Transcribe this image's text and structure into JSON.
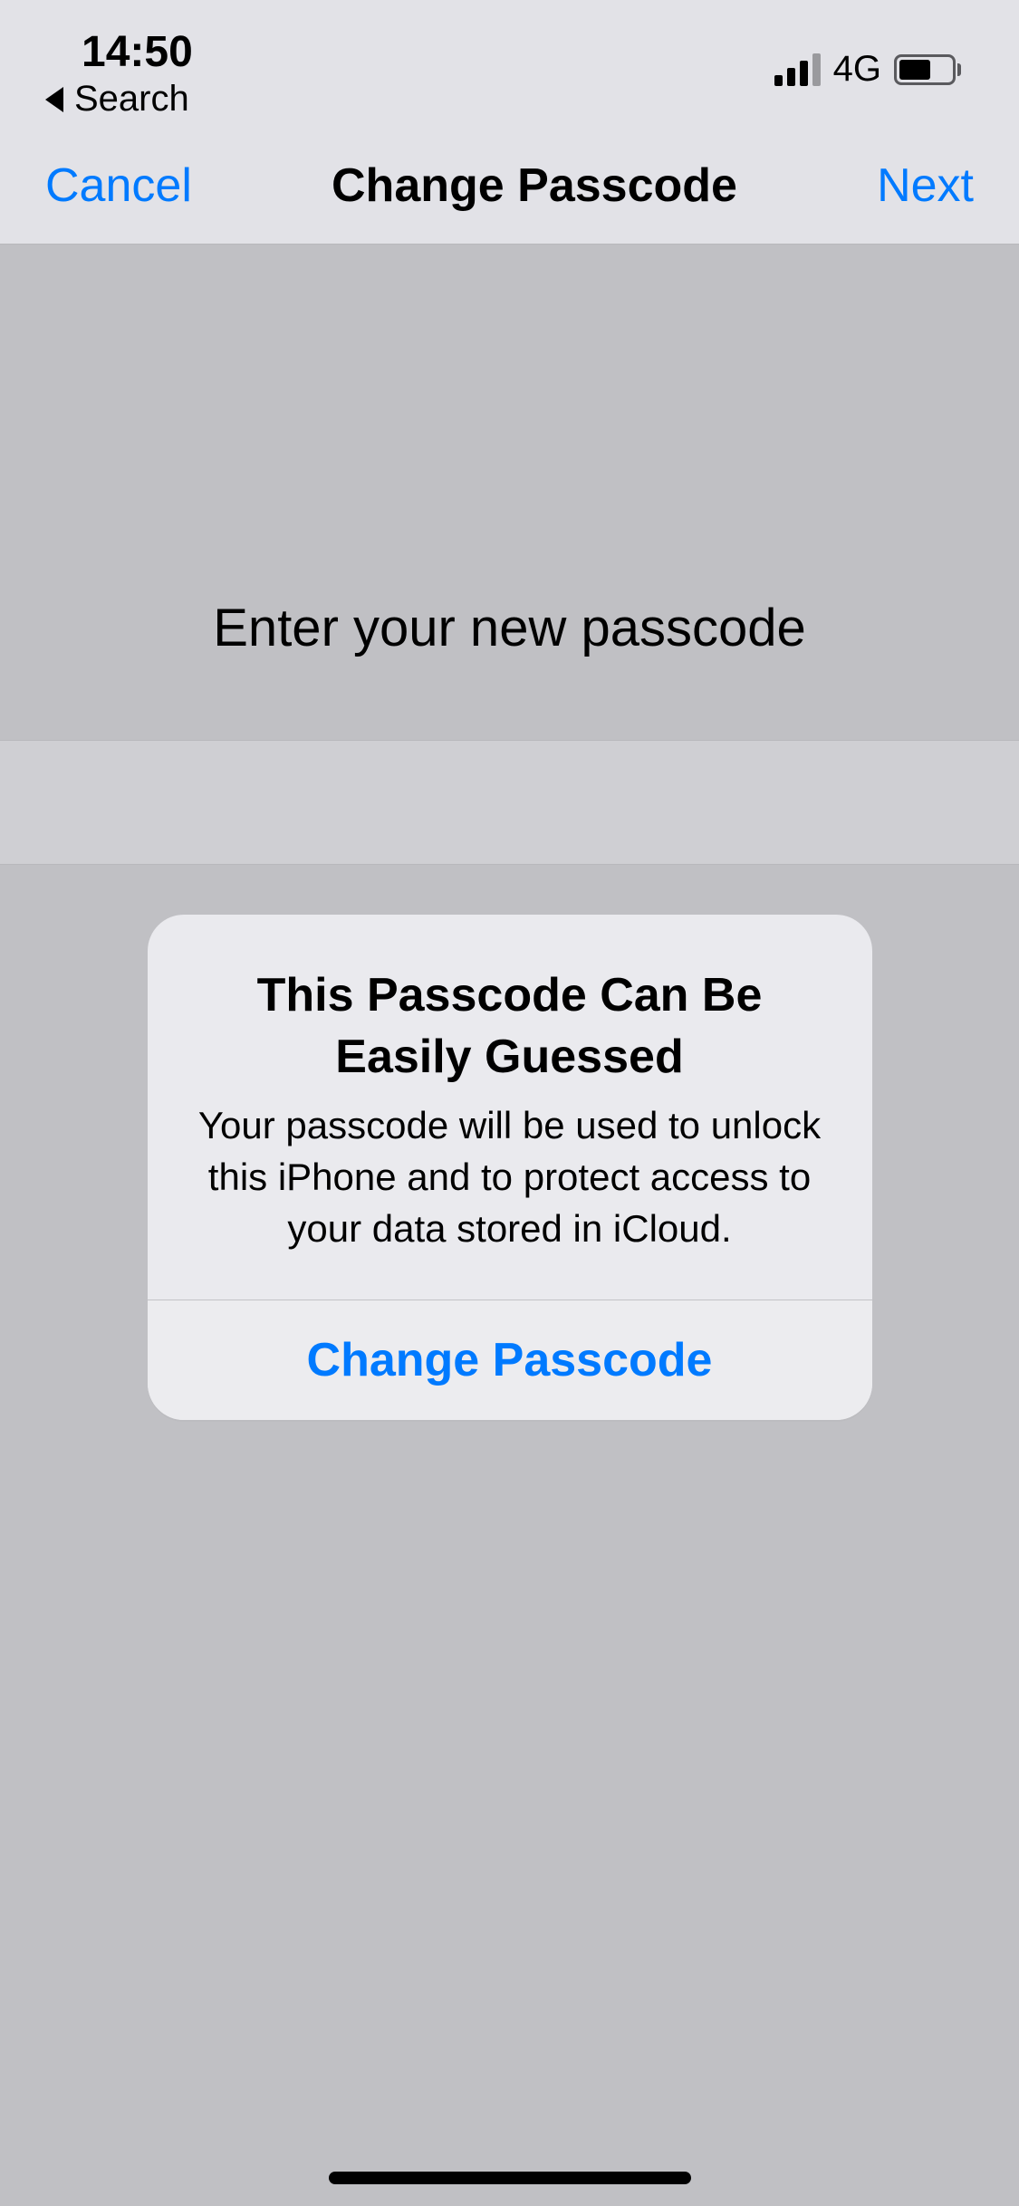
{
  "status": {
    "time": "14:50",
    "back_label": "Search",
    "network": "4G"
  },
  "nav": {
    "left": "Cancel",
    "title": "Change Passcode",
    "right": "Next"
  },
  "content": {
    "prompt": "Enter your new passcode"
  },
  "alert": {
    "title": "This Passcode Can Be Easily Guessed",
    "message": "Your passcode will be used to unlock this iPhone and to protect access to your data stored in iCloud.",
    "action": "Change Passcode"
  }
}
